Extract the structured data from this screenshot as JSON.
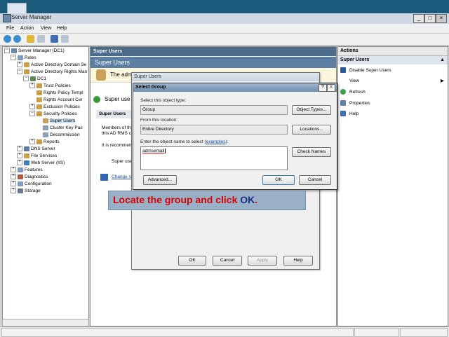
{
  "window": {
    "title": "Server Manager",
    "minimize": "_",
    "maximize": "□",
    "close": "×"
  },
  "menu": [
    "File",
    "Action",
    "View",
    "Help"
  ],
  "tree": {
    "items": [
      {
        "label": "Server Manager (DC1)",
        "level": 0
      },
      {
        "label": "Roles",
        "level": 1
      },
      {
        "label": "Active Directory Domain Se",
        "level": 2
      },
      {
        "label": "Active Directory Rights Man",
        "level": 2
      },
      {
        "label": "DC1",
        "level": 3
      },
      {
        "label": "Trust Policies",
        "level": 4
      },
      {
        "label": "Rights Policy Templ",
        "level": 4
      },
      {
        "label": "Rights Account Cer",
        "level": 4
      },
      {
        "label": "Exclusion Policies",
        "level": 4
      },
      {
        "label": "Security Policies",
        "level": 4
      },
      {
        "label": "Super Users",
        "level": 5
      },
      {
        "label": "Cluster Key Pas",
        "level": 5
      },
      {
        "label": "Decommission",
        "level": 5
      },
      {
        "label": "Reports",
        "level": 4
      },
      {
        "label": "DNS Server",
        "level": 2
      },
      {
        "label": "File Services",
        "level": 2
      },
      {
        "label": "Web Server (IIS)",
        "level": 2
      },
      {
        "label": "Features",
        "level": 1
      },
      {
        "label": "Diagnostics",
        "level": 1
      },
      {
        "label": "Configuration",
        "level": 1
      },
      {
        "label": "Storage",
        "level": 1
      }
    ]
  },
  "center": {
    "header": "Super Users",
    "band_title": "Super Users",
    "intro_text": "The adm",
    "status_text": "Super use",
    "sub_header": "Super Users",
    "members_text": "Members of th",
    "members_text2": "this AD RMS cl",
    "recommend_text": "It is recommen",
    "super_text": "Super use",
    "change_link": "Change s"
  },
  "super_dialog": {
    "title": "Super Users",
    "ok": "OK",
    "cancel": "Cancel",
    "apply": "Apply",
    "help": "Help"
  },
  "select_group": {
    "title": "Select Group",
    "help_btn": "?",
    "close_btn": "×",
    "object_type_label": "Select this object type:",
    "object_type_value": "Group",
    "object_types_btn": "Object Types...",
    "location_label": "From this location:",
    "location_value": "Entire Directory",
    "locations_btn": "Locations...",
    "enter_label_prefix": "Enter the object name to select (",
    "enter_label_link": "examples",
    "enter_label_suffix": "):",
    "object_name_value": "admsemail",
    "check_names_btn": "Check Names",
    "advanced_btn": "Advanced...",
    "ok_btn": "OK",
    "cancel_btn": "Cancel"
  },
  "callout": {
    "text_prefix": "Locate the group and click ",
    "text_ok": "OK",
    "text_suffix": "."
  },
  "actions": {
    "header": "Actions",
    "section": "Super Users",
    "items": [
      {
        "label": "Disable Super Users",
        "icon": "disable-icon"
      },
      {
        "label": "View",
        "icon": "none"
      },
      {
        "label": "Refresh",
        "icon": "refresh-icon"
      },
      {
        "label": "Properties",
        "icon": "properties-icon"
      },
      {
        "label": "Help",
        "icon": "help-icon"
      }
    ]
  }
}
